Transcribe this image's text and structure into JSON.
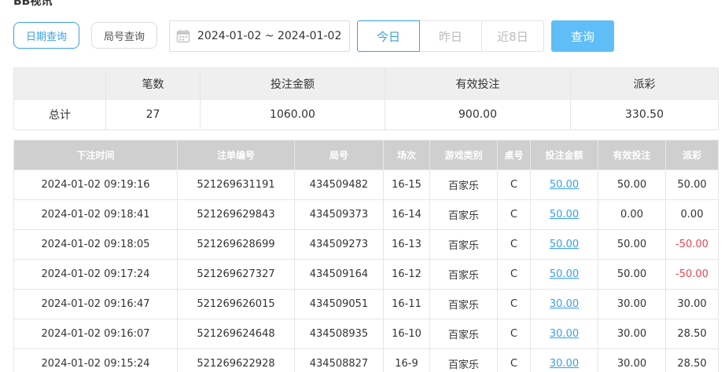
{
  "page": {
    "top_heading": "BB视讯"
  },
  "toolbar": {
    "tab_date": "日期查询",
    "tab_round": "局号查询",
    "date_range": "2024-01-02 ~ 2024-01-02",
    "quick": [
      "今日",
      "昨日",
      "近8日"
    ],
    "query_label": "查询"
  },
  "summary": {
    "headers": [
      "",
      "笔数",
      "投注金额",
      "有效投注",
      "派彩"
    ],
    "total": {
      "label": "总计",
      "count": "27",
      "bet": "1060.00",
      "valid": "900.00",
      "payout": "330.50"
    }
  },
  "detail": {
    "headers": [
      "下注时间",
      "注单编号",
      "局号",
      "场次",
      "游戏类别",
      "桌号",
      "投注金额",
      "有效投注",
      "派彩"
    ],
    "rows": [
      {
        "time": "2024-01-02 09:19:16",
        "order": "521269631191",
        "round": "434509482",
        "session": "16-15",
        "game": "百家乐",
        "table": "C",
        "bet": "50.00",
        "valid": "50.00",
        "payout": "50.00",
        "neg": false
      },
      {
        "time": "2024-01-02 09:18:41",
        "order": "521269629843",
        "round": "434509373",
        "session": "16-14",
        "game": "百家乐",
        "table": "C",
        "bet": "50.00",
        "valid": "0.00",
        "payout": "0.00",
        "neg": false
      },
      {
        "time": "2024-01-02 09:18:05",
        "order": "521269628699",
        "round": "434509273",
        "session": "16-13",
        "game": "百家乐",
        "table": "C",
        "bet": "50.00",
        "valid": "50.00",
        "payout": "-50.00",
        "neg": true
      },
      {
        "time": "2024-01-02 09:17:24",
        "order": "521269627327",
        "round": "434509164",
        "session": "16-12",
        "game": "百家乐",
        "table": "C",
        "bet": "50.00",
        "valid": "50.00",
        "payout": "-50.00",
        "neg": true
      },
      {
        "time": "2024-01-02 09:16:47",
        "order": "521269626015",
        "round": "434509051",
        "session": "16-11",
        "game": "百家乐",
        "table": "C",
        "bet": "30.00",
        "valid": "30.00",
        "payout": "30.00",
        "neg": false
      },
      {
        "time": "2024-01-02 09:16:07",
        "order": "521269624648",
        "round": "434508935",
        "session": "16-10",
        "game": "百家乐",
        "table": "C",
        "bet": "30.00",
        "valid": "30.00",
        "payout": "28.50",
        "neg": false
      },
      {
        "time": "2024-01-02 09:15:24",
        "order": "521269622928",
        "round": "434508827",
        "session": "16-9",
        "game": "百家乐",
        "table": "C",
        "bet": "30.00",
        "valid": "30.00",
        "payout": "28.50",
        "neg": false
      }
    ]
  },
  "colors": {
    "accent": "#3aa0e8",
    "query_bg": "#5fbdf7",
    "negative": "#e8454f",
    "detail_header_bg": "#cfcfcf",
    "summary_header_bg": "#efefef"
  }
}
